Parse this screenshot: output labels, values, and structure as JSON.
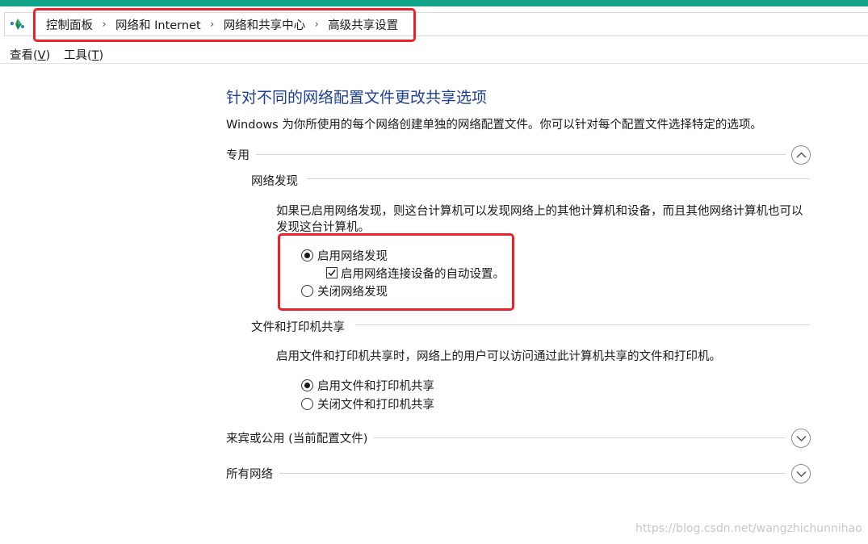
{
  "address_bar": {
    "crumbs": [
      "控制面板",
      "网络和 Internet",
      "网络和共享中心",
      "高级共享设置"
    ],
    "separator": "›",
    "icon": "network-globe-icon"
  },
  "menu": {
    "view_label": "查看(",
    "view_key": "V",
    "view_close": ")",
    "tools_label": "工具(",
    "tools_key": "T",
    "tools_close": ")"
  },
  "page": {
    "title": "针对不同的网络配置文件更改共享选项",
    "description": "Windows 为你所使用的每个网络创建单独的网络配置文件。你可以针对每个配置文件选择特定的选项。"
  },
  "profiles": {
    "private": {
      "label": "专用",
      "expanded": true,
      "network_discovery": {
        "heading": "网络发现",
        "description": "如果已启用网络发现，则这台计算机可以发现网络上的其他计算机和设备，而且其他网络计算机也可以发现这台计算机。",
        "on_label": "启用网络发现",
        "auto_setup_label": "启用网络连接设备的自动设置。",
        "off_label": "关闭网络发现",
        "selected": "on",
        "auto_setup_checked": true
      },
      "file_printer_sharing": {
        "heading": "文件和打印机共享",
        "description": "启用文件和打印机共享时，网络上的用户可以访问通过此计算机共享的文件和打印机。",
        "on_label": "启用文件和打印机共享",
        "off_label": "关闭文件和打印机共享",
        "selected": "on"
      }
    },
    "guest_public": {
      "label": "来宾或公用 (当前配置文件)",
      "expanded": false
    },
    "all_networks": {
      "label": "所有网络",
      "expanded": false
    }
  },
  "watermark": "https://blog.csdn.net/wangzhichunnihao",
  "colors": {
    "accent_strip": "#13a589",
    "title_blue": "#1e3f97",
    "highlight_red": "#e8232c"
  }
}
